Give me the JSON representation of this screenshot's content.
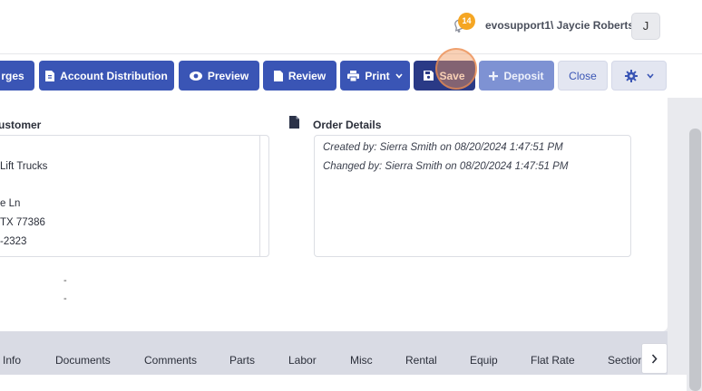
{
  "header": {
    "notification_count": "14",
    "user_label": "evosupport1\\ Jaycie Roberts",
    "avatar_initial": "J"
  },
  "toolbar": {
    "charges_label": "rges",
    "account_distribution_label": "Account Distribution",
    "preview_label": "Preview",
    "review_label": "Review",
    "print_label": "Print",
    "save_label": "Save",
    "deposit_label": "Deposit",
    "close_label": "Close"
  },
  "customer": {
    "title": "ustomer",
    "lines": [
      "Lift Trucks",
      "e Ln",
      "TX 77386",
      "-2323"
    ],
    "dash1": "-",
    "dash2": "-"
  },
  "order_details": {
    "title": "Order Details",
    "created": "Created by: Sierra Smith on 08/20/2024 1:47:51 PM",
    "changed": "Changed by: Sierra Smith on 08/20/2024 1:47:51 PM"
  },
  "tabs": [
    "Info",
    "Documents",
    "Comments",
    "Parts",
    "Labor",
    "Misc",
    "Rental",
    "Equip",
    "Flat Rate",
    "Section"
  ],
  "colors": {
    "primary": "#3a55b5",
    "primary_dark": "#2a3a86",
    "disabled": "#7e92d3",
    "badge": "#f5a623"
  }
}
